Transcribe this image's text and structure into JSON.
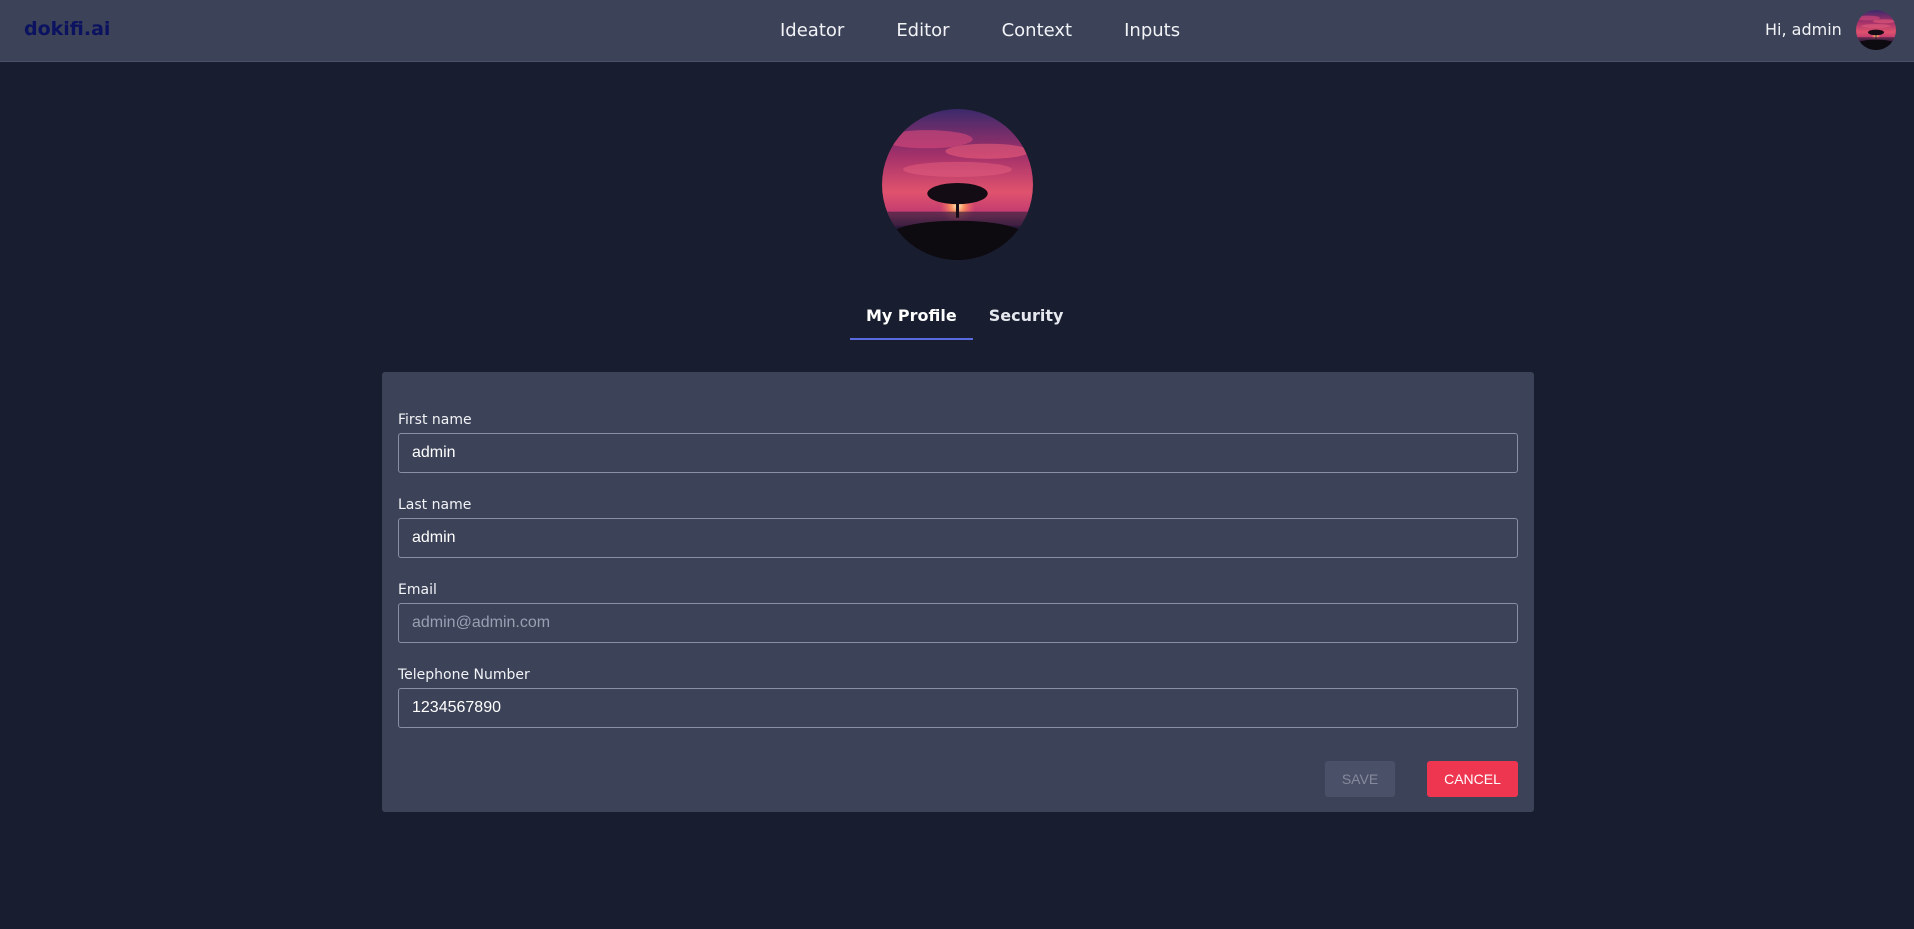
{
  "header": {
    "logo": "dokifi.ai",
    "nav": [
      {
        "label": "Ideator"
      },
      {
        "label": "Editor"
      },
      {
        "label": "Context"
      },
      {
        "label": "Inputs"
      }
    ],
    "greeting": "Hi, admin"
  },
  "tabs": [
    {
      "label": "My Profile",
      "active": true
    },
    {
      "label": "Security",
      "active": false
    }
  ],
  "form": {
    "first_name": {
      "label": "First name",
      "value": "admin"
    },
    "last_name": {
      "label": "Last name",
      "value": "admin"
    },
    "email": {
      "label": "Email",
      "value": "admin@admin.com",
      "readonly": true
    },
    "telephone": {
      "label": "Telephone Number",
      "value": "1234567890"
    },
    "save_label": "SAVE",
    "cancel_label": "CANCEL"
  },
  "colors": {
    "page_bg": "#181d2f",
    "navbar_bg": "#3c4257",
    "card_bg": "#3c4257",
    "tab_indicator": "#5a6be0",
    "cancel_bg": "#ef3651",
    "save_disabled_bg": "#4a5068"
  },
  "icons": {
    "profile_image": "sunset-tree-image"
  }
}
